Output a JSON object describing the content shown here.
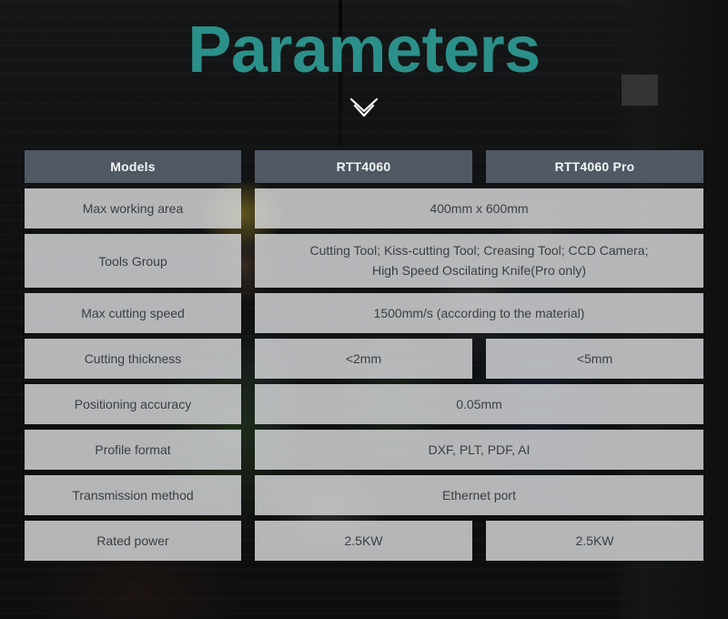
{
  "hero": {
    "title": "Parameters",
    "scroll_icon": "double-chevron-down-icon",
    "title_color": "#2b9089",
    "icon_color": "#ffffff"
  },
  "table": {
    "header": {
      "label": "Models",
      "model_a": "RTT4060",
      "model_b": "RTT4060 Pro"
    },
    "header_bg": "#606a78",
    "cell_bg": "#dee0e2",
    "rows": [
      {
        "label": "Max working area",
        "layout": "merged",
        "value": "400mm x 600mm"
      },
      {
        "label": "Tools Group",
        "layout": "merged",
        "value_line1": "Cutting Tool; Kiss-cutting Tool; Creasing Tool; CCD Camera;",
        "value_line2": "High Speed Oscilating Knife(Pro only)"
      },
      {
        "label": "Max cutting speed",
        "layout": "merged",
        "value": "1500mm/s   (according to the material)"
      },
      {
        "label": "Cutting thickness",
        "layout": "split",
        "value_a": "<2mm",
        "value_b": "<5mm"
      },
      {
        "label": "Positioning accuracy",
        "layout": "merged",
        "value": "0.05mm"
      },
      {
        "label": "Profile format",
        "layout": "merged",
        "value": "DXF, PLT, PDF, AI"
      },
      {
        "label": "Transmission method",
        "layout": "merged",
        "value": "Ethernet port"
      },
      {
        "label": "Rated power",
        "layout": "split",
        "value_a": "2.5KW",
        "value_b": "2.5KW"
      }
    ]
  }
}
